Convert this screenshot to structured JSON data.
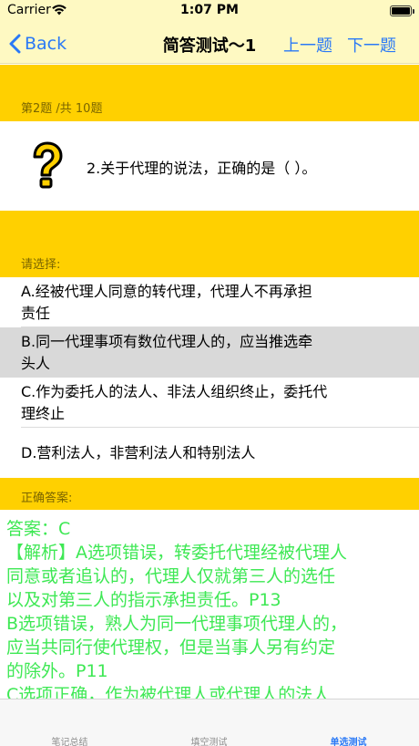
{
  "status_bar": {
    "carrier": "Carrier",
    "time": "1:07 PM"
  },
  "nav": {
    "back_label": "Back",
    "title": "简答测试～1",
    "prev_label": "上一题",
    "next_label": "下一题"
  },
  "question": {
    "counter": "第2题 /共 10题",
    "text": "2.关于代理的说法，正确的是（ ）。"
  },
  "options_section": {
    "label": "请选择:"
  },
  "options": [
    {
      "line1": "A.经被代理人同意的转代理，代理人不再承担",
      "line2": "责任"
    },
    {
      "line1": "B.同一代理事项有数位代理人的，应当推选牵",
      "line2": "头人"
    },
    {
      "line1": "C.作为委托人的法人、非法人组织终止，委托代",
      "line2": "理终止"
    },
    {
      "line1": "D.营利法人，非营利法人和特别法人",
      "line2": ""
    }
  ],
  "selected_option": "B",
  "answer_section": {
    "label": "正确答案:"
  },
  "answer_lines": [
    "答案：C",
    "【解析】A选项错误，转委托代理经被代理人",
    "同意或者追认的，代理人仅就第三人的选任",
    "以及对第三人的指示承担责任。P13",
    "B选项错误，熟人为同一代理事项代理人的，",
    "应当共同行使代理权，但是当事人另有约定",
    "的除外。P11",
    "C选项正确，作为被代理人或代理人的法人"
  ],
  "colors": {
    "accent": "#2a79f6",
    "section_yellow": "#ffd000",
    "answer_green": "#3ee854",
    "nav_background": "#fef9c2"
  },
  "icons": {
    "question": "question-mark-icon",
    "wifi": "wifi-icon",
    "battery": "battery-icon",
    "back": "chevron-left-icon"
  },
  "tabbar": {
    "tabs": [
      {
        "label": "笔记总结",
        "active": false
      },
      {
        "label": "填空测试",
        "active": false
      },
      {
        "label": "单选测试",
        "active": true
      }
    ]
  }
}
